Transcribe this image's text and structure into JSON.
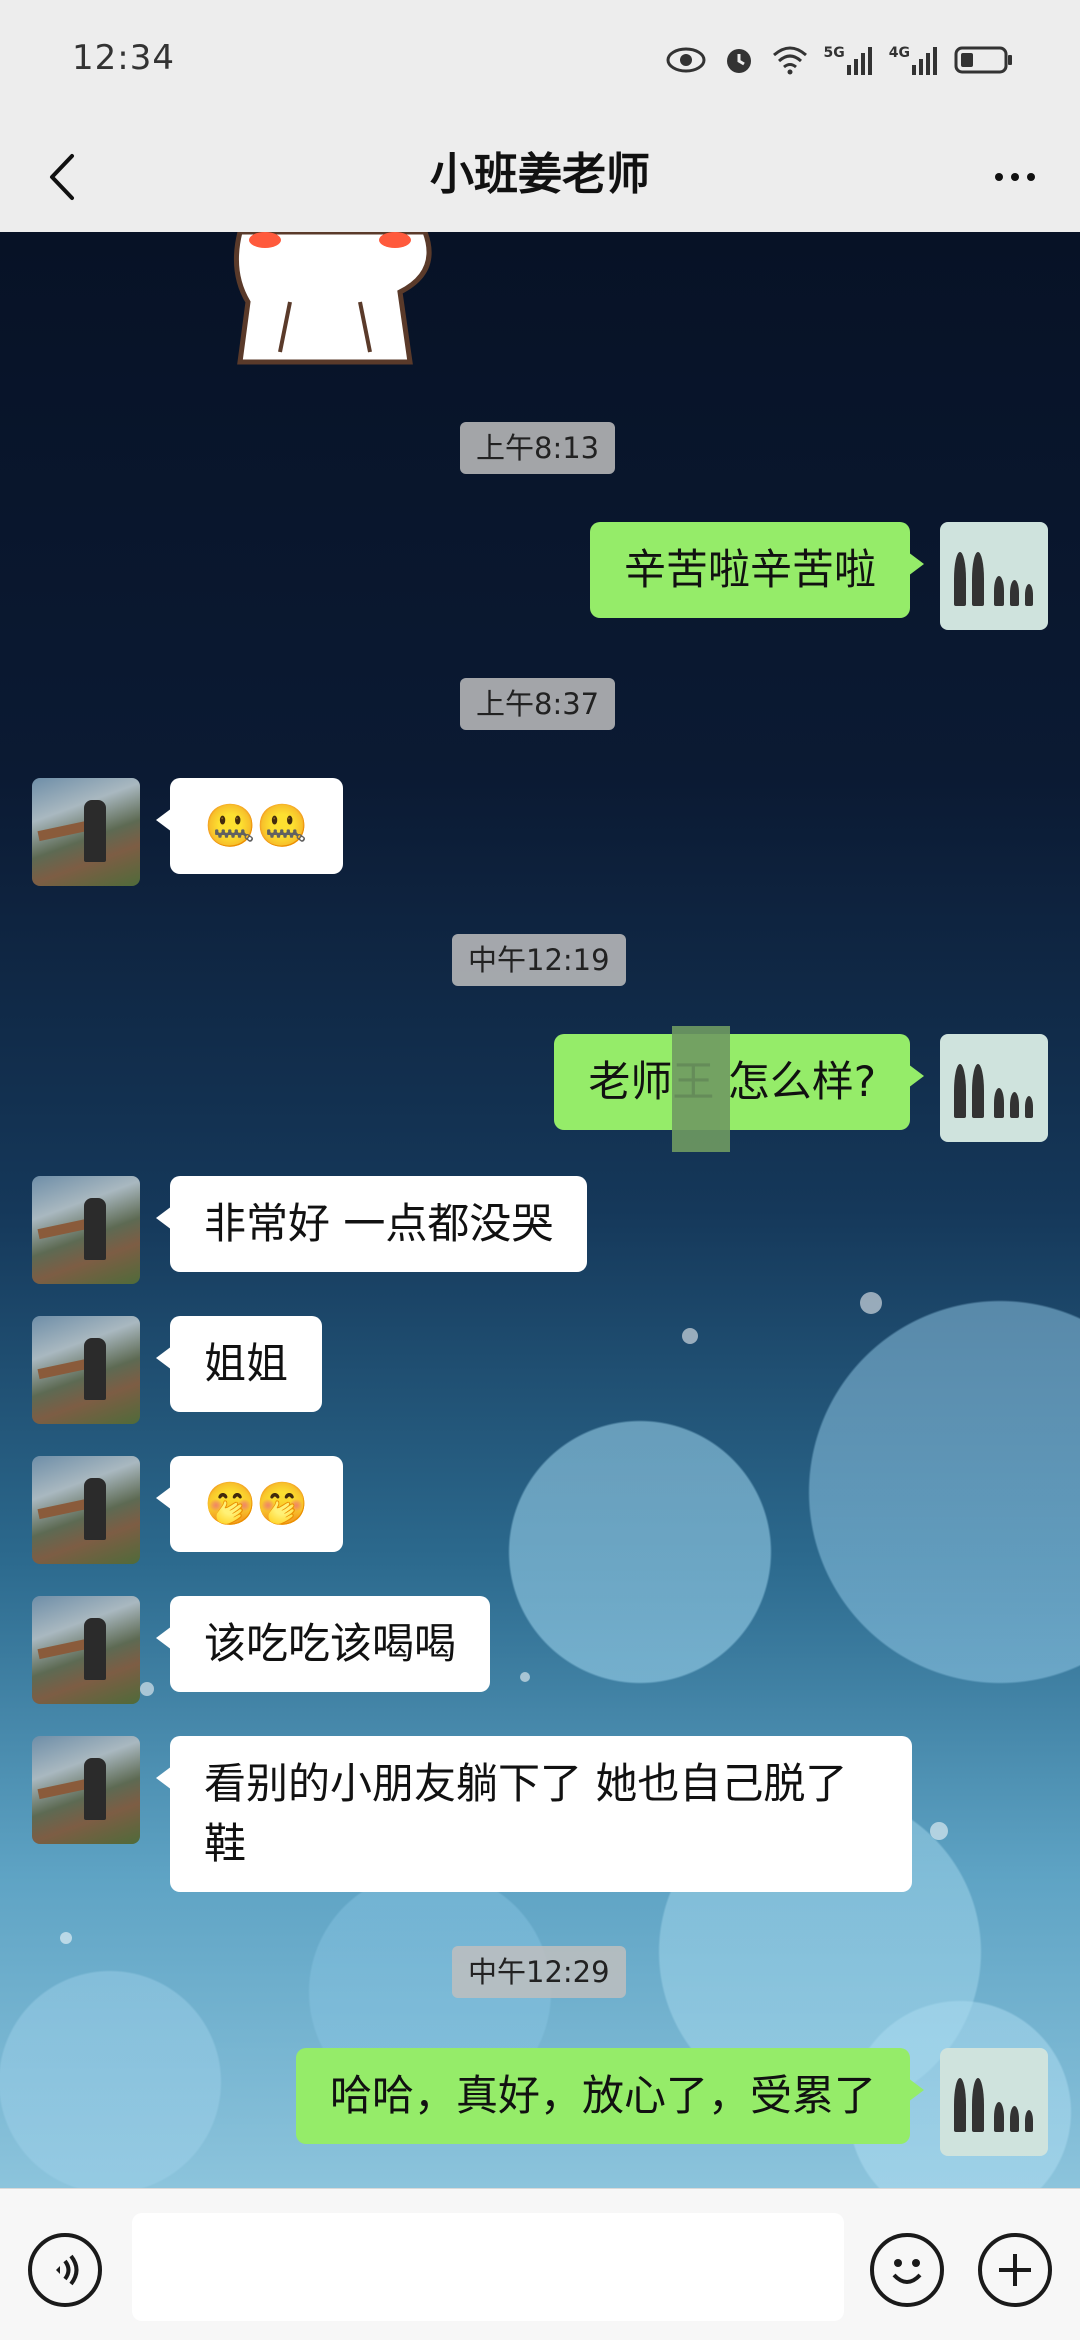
{
  "status_bar": {
    "time": "12:34",
    "network_1": "5G",
    "network_2": "4G"
  },
  "header": {
    "title": "小班姜老师",
    "back_icon": "chevron-left-icon",
    "more_icon": "more-horizontal-icon"
  },
  "messages": {
    "time_1": "上午8:13",
    "msg_1": "辛苦啦辛苦啦",
    "time_2": "上午8:37",
    "msg_2": "🤐🤐",
    "time_3": "中午12:19",
    "msg_3": "老师王  怎么样?",
    "msg_4": "非常好 一点都没哭",
    "msg_5": "姐姐",
    "msg_6": "🤭🤭",
    "msg_7": "该吃吃该喝喝",
    "msg_8": "看别的小朋友躺下了 她也自己脱了鞋",
    "time_4": "中午12:29",
    "msg_9": "哈哈，真好，放心了，受累了"
  },
  "input_bar": {
    "voice_icon": "voice-icon",
    "emoji_icon": "smiley-icon",
    "plus_icon": "plus-circle-icon",
    "input_value": ""
  },
  "colors": {
    "self_bubble": "#95ec69",
    "other_bubble": "#ffffff",
    "bar_bg": "#ededed"
  }
}
